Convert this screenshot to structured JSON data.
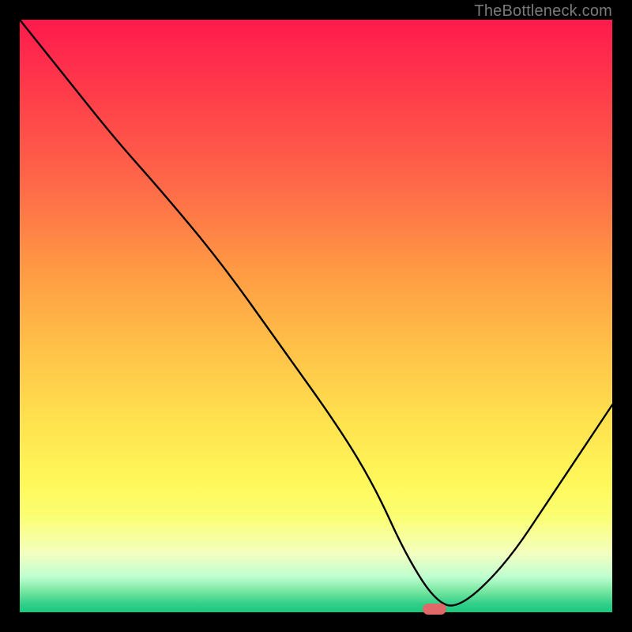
{
  "watermark": "TheBottleneck.com",
  "chart_data": {
    "type": "line",
    "title": "",
    "xlabel": "",
    "ylabel": "",
    "xlim": [
      0,
      100
    ],
    "ylim": [
      0,
      100
    ],
    "grid": false,
    "background_gradient": {
      "stops": [
        {
          "pos": 0.0,
          "color": "#ff1a4d"
        },
        {
          "pos": 0.12,
          "color": "#ff3b4a"
        },
        {
          "pos": 0.28,
          "color": "#ff6948"
        },
        {
          "pos": 0.42,
          "color": "#ff9944"
        },
        {
          "pos": 0.55,
          "color": "#ffc048"
        },
        {
          "pos": 0.68,
          "color": "#ffe24f"
        },
        {
          "pos": 0.78,
          "color": "#fff85a"
        },
        {
          "pos": 0.84,
          "color": "#fbff74"
        },
        {
          "pos": 0.9,
          "color": "#f4ffc0"
        },
        {
          "pos": 0.94,
          "color": "#bfffd0"
        },
        {
          "pos": 0.965,
          "color": "#75e6a0"
        },
        {
          "pos": 0.985,
          "color": "#35d08a"
        },
        {
          "pos": 1.0,
          "color": "#17c87e"
        }
      ]
    },
    "series": [
      {
        "name": "bottleneck-curve",
        "color": "#000000",
        "x": [
          0.0,
          8.0,
          16.0,
          24.0,
          34.0,
          44.0,
          54.0,
          60.0,
          65.0,
          70.0,
          74.0,
          82.0,
          90.0,
          100.0
        ],
        "y": [
          100.0,
          90.0,
          80.0,
          71.0,
          59.0,
          45.0,
          31.0,
          21.0,
          10.0,
          2.0,
          0.5,
          8.0,
          20.0,
          35.0
        ]
      }
    ],
    "marker": {
      "x": 70.0,
      "y": 0.5,
      "color": "#e06868",
      "shape": "pill"
    }
  }
}
